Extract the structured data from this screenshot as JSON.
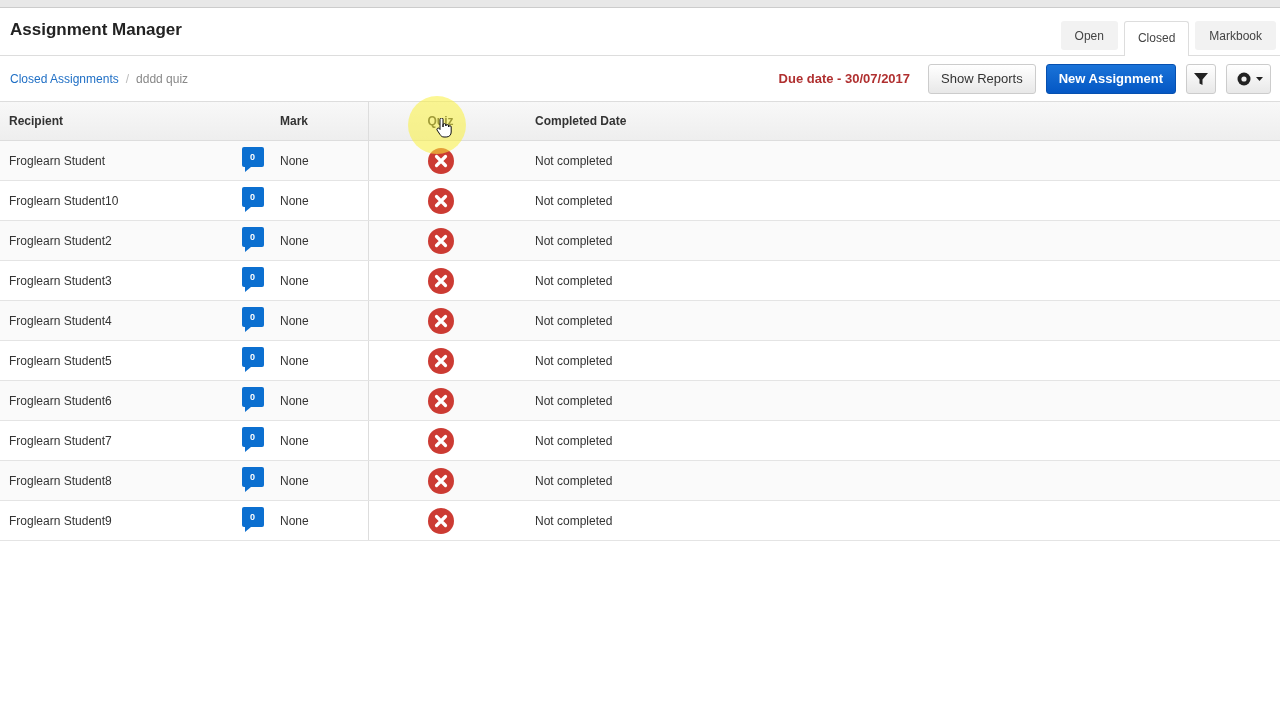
{
  "title": "Assignment Manager",
  "tabs": [
    {
      "label": "Open",
      "selected": false
    },
    {
      "label": "Closed",
      "selected": true
    },
    {
      "label": "Markbook",
      "selected": false
    }
  ],
  "breadcrumb": {
    "link": "Closed Assignments",
    "separator": "/",
    "current": "dddd quiz"
  },
  "due_date": "Due date - 30/07/2017",
  "buttons": {
    "reports": "Show Reports",
    "new": "New Assignment"
  },
  "table": {
    "columns": [
      "Recipient",
      "Mark",
      "Quiz",
      "Completed Date"
    ],
    "rows": [
      {
        "recipient": "Froglearn Student",
        "comments": "0",
        "mark": "None",
        "completed": false,
        "completed_date": "Not completed"
      },
      {
        "recipient": "Froglearn Student10",
        "comments": "0",
        "mark": "None",
        "completed": false,
        "completed_date": "Not completed"
      },
      {
        "recipient": "Froglearn Student2",
        "comments": "0",
        "mark": "None",
        "completed": false,
        "completed_date": "Not completed"
      },
      {
        "recipient": "Froglearn Student3",
        "comments": "0",
        "mark": "None",
        "completed": false,
        "completed_date": "Not completed"
      },
      {
        "recipient": "Froglearn Student4",
        "comments": "0",
        "mark": "None",
        "completed": false,
        "completed_date": "Not completed"
      },
      {
        "recipient": "Froglearn Student5",
        "comments": "0",
        "mark": "None",
        "completed": false,
        "completed_date": "Not completed"
      },
      {
        "recipient": "Froglearn Student6",
        "comments": "0",
        "mark": "None",
        "completed": false,
        "completed_date": "Not completed"
      },
      {
        "recipient": "Froglearn Student7",
        "comments": "0",
        "mark": "None",
        "completed": false,
        "completed_date": "Not completed"
      },
      {
        "recipient": "Froglearn Student8",
        "comments": "0",
        "mark": "None",
        "completed": false,
        "completed_date": "Not completed"
      },
      {
        "recipient": "Froglearn Student9",
        "comments": "0",
        "mark": "None",
        "completed": false,
        "completed_date": "Not completed"
      }
    ]
  }
}
